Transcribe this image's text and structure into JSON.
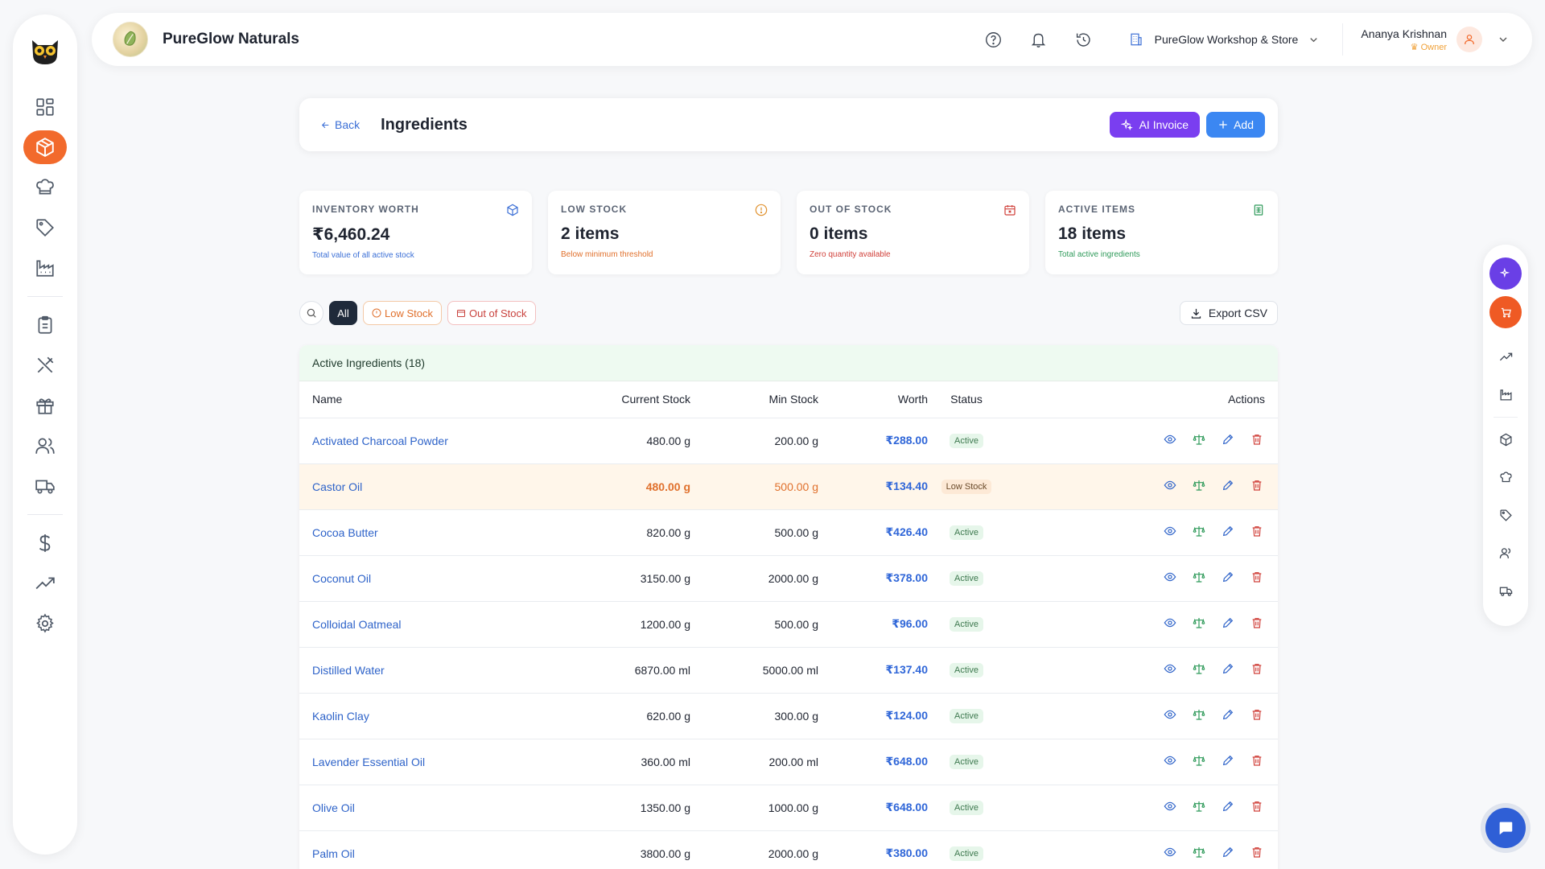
{
  "brand": {
    "name": "PureGlow Naturals"
  },
  "header": {
    "store_name": "PureGlow Workshop & Store",
    "user_name": "Ananya Krishnan",
    "user_role": "Owner"
  },
  "page": {
    "back_label": "Back",
    "title": "Ingredients",
    "ai_invoice_label": "AI Invoice",
    "add_label": "Add"
  },
  "stats": [
    {
      "label": "INVENTORY WORTH",
      "value": "₹6,460.24",
      "sub": "Total value of all active stock",
      "sub_color": "#3b6fd6",
      "icon": "cube-icon"
    },
    {
      "label": "LOW STOCK",
      "value": "2 items",
      "sub": "Below minimum threshold",
      "sub_color": "#e0702c",
      "icon": "alert-circle-icon"
    },
    {
      "label": "OUT OF STOCK",
      "value": "0 items",
      "sub": "Zero quantity available",
      "sub_color": "#d0403a",
      "icon": "calendar-x-icon"
    },
    {
      "label": "ACTIVE ITEMS",
      "value": "18 items",
      "sub": "Total active ingredients",
      "sub_color": "#2f9a5a",
      "icon": "sheet-icon"
    }
  ],
  "filters": {
    "all_label": "All",
    "low_label": "Low Stock",
    "out_label": "Out of Stock",
    "export_label": "Export CSV"
  },
  "table": {
    "caption": "Active Ingredients (18)",
    "columns": [
      "Name",
      "Current Stock",
      "Min Stock",
      "Worth",
      "Status",
      "Actions"
    ],
    "rows": [
      {
        "name": "Activated Charcoal Powder",
        "current": "480.00 g",
        "min": "200.00 g",
        "worth": "₹288.00",
        "status": "Active"
      },
      {
        "name": "Castor Oil",
        "current": "480.00 g",
        "min": "500.00 g",
        "worth": "₹134.40",
        "status": "Low Stock"
      },
      {
        "name": "Cocoa Butter",
        "current": "820.00 g",
        "min": "500.00 g",
        "worth": "₹426.40",
        "status": "Active"
      },
      {
        "name": "Coconut Oil",
        "current": "3150.00 g",
        "min": "2000.00 g",
        "worth": "₹378.00",
        "status": "Active"
      },
      {
        "name": "Colloidal Oatmeal",
        "current": "1200.00 g",
        "min": "500.00 g",
        "worth": "₹96.00",
        "status": "Active"
      },
      {
        "name": "Distilled Water",
        "current": "6870.00 ml",
        "min": "5000.00 ml",
        "worth": "₹137.40",
        "status": "Active"
      },
      {
        "name": "Kaolin Clay",
        "current": "620.00 g",
        "min": "300.00 g",
        "worth": "₹124.00",
        "status": "Active"
      },
      {
        "name": "Lavender Essential Oil",
        "current": "360.00 ml",
        "min": "200.00 ml",
        "worth": "₹648.00",
        "status": "Active"
      },
      {
        "name": "Olive Oil",
        "current": "1350.00 g",
        "min": "1000.00 g",
        "worth": "₹648.00",
        "status": "Active"
      },
      {
        "name": "Palm Oil",
        "current": "3800.00 g",
        "min": "2000.00 g",
        "worth": "₹380.00",
        "status": "Active"
      }
    ]
  },
  "colors": {
    "accent_orange": "#f26a2c",
    "ai_purple": "#7a3ef0",
    "add_blue": "#3b87f2",
    "link_blue": "#2e63c9"
  }
}
